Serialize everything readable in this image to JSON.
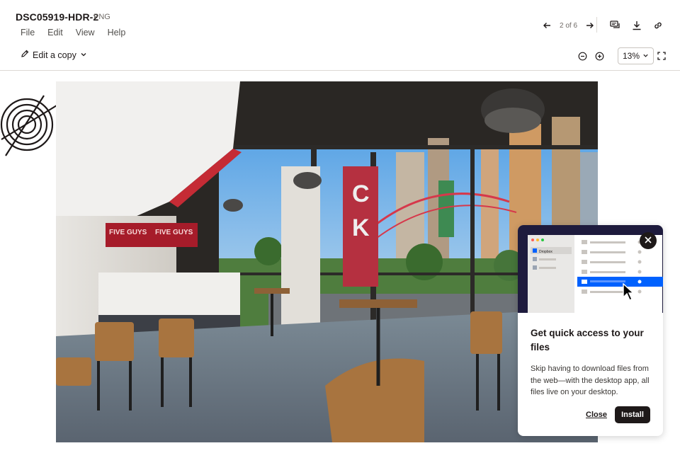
{
  "header": {
    "title": "DSC05919-HDR-2",
    "file_type": "PNG",
    "menu": [
      "File",
      "Edit",
      "View",
      "Help"
    ],
    "page_counter": "2 of 6",
    "edit_copy_label": "Edit a copy",
    "zoom": "13%"
  },
  "promo": {
    "title": "Get quick access to your files",
    "body": "Skip having to download files from the web—with the desktop app, all files live on your desktop.",
    "close_label": "Close",
    "install_label": "Install",
    "mock_sidebar_label": "Dropbox"
  },
  "photo": {
    "sign_left": "FIVE GUYS",
    "sign_right": "FIVE GUYS"
  },
  "colors": {
    "accent_blue": "#0061fe",
    "dark": "#1e1919",
    "hero_bg": "#1e1b3d"
  },
  "icons": [
    "arrow-left-icon",
    "arrow-right-icon",
    "comment-icon",
    "download-icon",
    "link-icon",
    "pencil-icon",
    "chevron-down-icon",
    "zoom-out-icon",
    "zoom-in-icon",
    "fullscreen-icon",
    "close-icon",
    "cursor-icon"
  ]
}
